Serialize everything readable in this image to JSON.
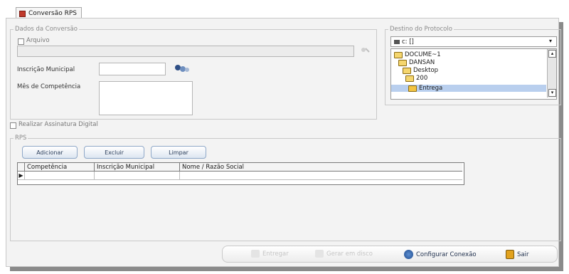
{
  "tab": {
    "label": "Conversão RPS"
  },
  "conversion": {
    "legend": "Dados da Conversão",
    "arquivo_label": "Arquivo",
    "inscricao_label": "Inscrição Municipal",
    "mes_label": "Mês de Competência"
  },
  "destino": {
    "legend": "Destino do Protocolo",
    "drive": "c: []",
    "folders": [
      "DOCUME~1",
      "DANSAN",
      "Desktop",
      "200",
      "Entrega"
    ]
  },
  "assinatura_label": "Realizar Assinatura Digital",
  "rps": {
    "legend": "RPS",
    "buttons": {
      "adicionar": "Adicionar",
      "excluir": "Excluir",
      "limpar": "Limpar"
    },
    "columns": [
      "Competência",
      "Inscrição Municipal",
      "Nome / Razão Social"
    ]
  },
  "toolbar": {
    "entregar": "Entregar",
    "gerar": "Gerar em disco",
    "configurar": "Configurar Conexão",
    "sair": "Sair"
  }
}
